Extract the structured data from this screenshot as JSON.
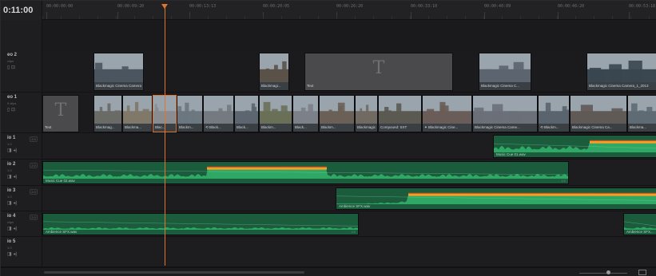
{
  "timecode": "0:11:00",
  "ruler_ticks": [
    "00:00:00:00",
    "00:00:09:20",
    "00:00:13:13",
    "00:00:20:05",
    "00:00:26:20",
    "00:00:33:10",
    "00:00:40:09",
    "00:00:46:20",
    "00:00:53:18"
  ],
  "headers": [
    {
      "name": "eo 2",
      "sub": "clips",
      "icon": "▯ ⊡",
      "button": ""
    },
    {
      "name": "eo 1",
      "sub": "9 clips",
      "icon": "▯ ⊡",
      "button": ""
    },
    {
      "name": "io 1",
      "sub": "1.0",
      "icon": "◨ ◂)",
      "button": "2.0"
    },
    {
      "name": "io 2",
      "sub": "1.0",
      "icon": "◨ ◂)",
      "button": "2.0"
    },
    {
      "name": "io 3",
      "sub": "1.0",
      "icon": "◨ ◂)",
      "button": "2.0"
    },
    {
      "name": "io 4",
      "sub": "clips",
      "icon": "◨ ◂)",
      "button": "2.0"
    },
    {
      "name": "io 5",
      "sub": "1.0",
      "icon": "◨ ◂)",
      "button": ""
    }
  ],
  "video2_clips": [
    {
      "label": "Blackmagic Cinema Camera_1_3...",
      "kind": "photo",
      "color": "#4b5560"
    },
    {
      "label": "Blackmagi...",
      "kind": "photo",
      "color": "#5a5248"
    },
    {
      "label": "Text",
      "kind": "title",
      "color": "#4a4a4c"
    },
    {
      "label": "Blackmagic Cinema C...",
      "kind": "photo",
      "color": "#5c6470"
    },
    {
      "label": "Blackmagic Cinema Camera_1_2013",
      "kind": "photo",
      "color": "#3a4650"
    }
  ],
  "video1_clips": [
    {
      "label": "Text",
      "kind": "title",
      "color": "#4a4a4c"
    },
    {
      "label": "Blackmag...",
      "kind": "photo",
      "color": "#6a6a66"
    },
    {
      "label": "Blackma...",
      "kind": "photo",
      "color": "#807868"
    },
    {
      "label": "Blac...",
      "kind": "photo",
      "color": "#8a8c90"
    },
    {
      "label": "Blackm...",
      "kind": "photo",
      "color": "#6c7780"
    },
    {
      "label": "⟲ Black...",
      "kind": "photo",
      "color": "#757a80"
    },
    {
      "label": "Black...",
      "kind": "photo",
      "color": "#5d6670"
    },
    {
      "label": "Blackm...",
      "kind": "photo",
      "color": "#6a7058"
    },
    {
      "label": "Black...",
      "kind": "photo",
      "color": "#7c8088"
    },
    {
      "label": "Blackm...",
      "kind": "photo",
      "color": "#6a6058"
    },
    {
      "label": "Blackmagic...",
      "kind": "photo",
      "color": "#706a62"
    },
    {
      "label": "Compound: SXT",
      "kind": "photo",
      "color": "#5a5a52"
    },
    {
      "label": "✦ Blackmagic Cine...",
      "kind": "photo",
      "color": "#6a5c58"
    },
    {
      "label": "Blackmagic Cinema Came...",
      "kind": "photo",
      "color": "#6c7078"
    },
    {
      "label": "⟲ Blackm...",
      "kind": "photo",
      "color": "#5a646e"
    },
    {
      "label": "Blackmagic Cinema Ca...",
      "kind": "photo",
      "color": "#605a56"
    },
    {
      "label": "Blackma...",
      "kind": "photo",
      "color": "#5e6a74"
    }
  ],
  "audio_clips": [
    {
      "lane": 0,
      "label": "Music Cue 01.wav",
      "end": ""
    },
    {
      "lane": 1,
      "label": "Music Cue 02.wav",
      "end": "1/2"
    },
    {
      "lane": 2,
      "label": "Ambience SFX.wav",
      "end": ""
    },
    {
      "lane": 3,
      "label": "Ambience SFX.wav",
      "end": "1/2"
    },
    {
      "lane": 3,
      "label": "Ambience SFX...",
      "end": ""
    }
  ],
  "colors": {
    "playhead": "#e0762b",
    "audio": "#1b5c3d",
    "wave": "#2fa866",
    "peak": "#f2a020"
  }
}
